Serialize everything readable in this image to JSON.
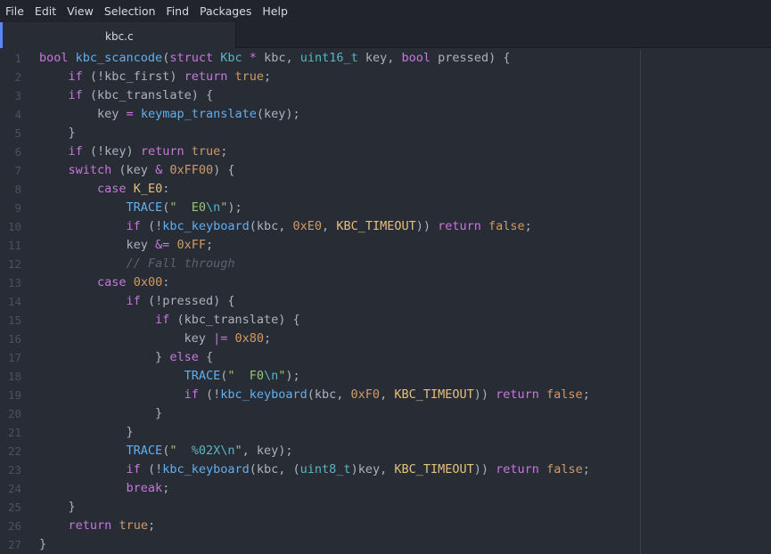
{
  "menubar": {
    "items": [
      "File",
      "Edit",
      "View",
      "Selection",
      "Find",
      "Packages",
      "Help"
    ]
  },
  "tabs": [
    {
      "title": "kbc.c",
      "active": true
    }
  ],
  "colors": {
    "background": "#282c34",
    "accent": "#568af2",
    "keyword": "#c678dd",
    "function": "#61afef",
    "type": "#56b6c2",
    "number": "#d19a66",
    "string": "#98c379",
    "comment": "#5c6370"
  },
  "editor": {
    "lines": [
      {
        "n": "1",
        "tokens": [
          [
            "kw",
            "bool"
          ],
          [
            "plain",
            " "
          ],
          [
            "fn",
            "kbc_scancode"
          ],
          [
            "plain",
            "("
          ],
          [
            "kw",
            "struct"
          ],
          [
            "plain",
            " "
          ],
          [
            "type",
            "Kbc"
          ],
          [
            "plain",
            " "
          ],
          [
            "op",
            "*"
          ],
          [
            "plain",
            " kbc, "
          ],
          [
            "type",
            "uint16_t"
          ],
          [
            "plain",
            " key, "
          ],
          [
            "kw",
            "bool"
          ],
          [
            "plain",
            " pressed) {"
          ]
        ]
      },
      {
        "n": "2",
        "tokens": [
          [
            "plain",
            "    "
          ],
          [
            "kw",
            "if"
          ],
          [
            "plain",
            " (!kbc_first) "
          ],
          [
            "kw",
            "return"
          ],
          [
            "plain",
            " "
          ],
          [
            "const",
            "true"
          ],
          [
            "plain",
            ";"
          ]
        ]
      },
      {
        "n": "3",
        "tokens": [
          [
            "plain",
            "    "
          ],
          [
            "kw",
            "if"
          ],
          [
            "plain",
            " (kbc_translate) {"
          ]
        ]
      },
      {
        "n": "4",
        "tokens": [
          [
            "plain",
            "        key "
          ],
          [
            "op",
            "="
          ],
          [
            "plain",
            " "
          ],
          [
            "fn",
            "keymap_translate"
          ],
          [
            "plain",
            "(key);"
          ]
        ]
      },
      {
        "n": "5",
        "tokens": [
          [
            "plain",
            "    }"
          ]
        ]
      },
      {
        "n": "6",
        "tokens": [
          [
            "plain",
            "    "
          ],
          [
            "kw",
            "if"
          ],
          [
            "plain",
            " (!key) "
          ],
          [
            "kw",
            "return"
          ],
          [
            "plain",
            " "
          ],
          [
            "const",
            "true"
          ],
          [
            "plain",
            ";"
          ]
        ]
      },
      {
        "n": "7",
        "tokens": [
          [
            "plain",
            "    "
          ],
          [
            "kw",
            "switch"
          ],
          [
            "plain",
            " (key "
          ],
          [
            "op",
            "&"
          ],
          [
            "plain",
            " "
          ],
          [
            "num",
            "0xFF00"
          ],
          [
            "plain",
            ") {"
          ]
        ]
      },
      {
        "n": "8",
        "tokens": [
          [
            "plain",
            "        "
          ],
          [
            "kw",
            "case"
          ],
          [
            "plain",
            " "
          ],
          [
            "ent",
            "K_E0"
          ],
          [
            "plain",
            ":"
          ]
        ]
      },
      {
        "n": "9",
        "tokens": [
          [
            "plain",
            "            "
          ],
          [
            "macro",
            "TRACE"
          ],
          [
            "plain",
            "("
          ],
          [
            "str",
            "\"  E0"
          ],
          [
            "esc",
            "\\n"
          ],
          [
            "str",
            "\""
          ],
          [
            "plain",
            ");"
          ]
        ]
      },
      {
        "n": "10",
        "tokens": [
          [
            "plain",
            "            "
          ],
          [
            "kw",
            "if"
          ],
          [
            "plain",
            " (!"
          ],
          [
            "fn",
            "kbc_keyboard"
          ],
          [
            "plain",
            "(kbc, "
          ],
          [
            "num",
            "0xE0"
          ],
          [
            "plain",
            ", "
          ],
          [
            "ent",
            "KBC_TIMEOUT"
          ],
          [
            "plain",
            ")) "
          ],
          [
            "kw",
            "return"
          ],
          [
            "plain",
            " "
          ],
          [
            "const",
            "false"
          ],
          [
            "plain",
            ";"
          ]
        ]
      },
      {
        "n": "11",
        "tokens": [
          [
            "plain",
            "            key "
          ],
          [
            "op",
            "&="
          ],
          [
            "plain",
            " "
          ],
          [
            "num",
            "0xFF"
          ],
          [
            "plain",
            ";"
          ]
        ]
      },
      {
        "n": "12",
        "tokens": [
          [
            "plain",
            "            "
          ],
          [
            "cmt",
            "// Fall through"
          ]
        ]
      },
      {
        "n": "13",
        "tokens": [
          [
            "plain",
            "        "
          ],
          [
            "kw",
            "case"
          ],
          [
            "plain",
            " "
          ],
          [
            "num",
            "0x00"
          ],
          [
            "plain",
            ":"
          ]
        ]
      },
      {
        "n": "14",
        "tokens": [
          [
            "plain",
            "            "
          ],
          [
            "kw",
            "if"
          ],
          [
            "plain",
            " (!pressed) {"
          ]
        ]
      },
      {
        "n": "15",
        "tokens": [
          [
            "plain",
            "                "
          ],
          [
            "kw",
            "if"
          ],
          [
            "plain",
            " (kbc_translate) {"
          ]
        ]
      },
      {
        "n": "16",
        "tokens": [
          [
            "plain",
            "                    key "
          ],
          [
            "op",
            "|="
          ],
          [
            "plain",
            " "
          ],
          [
            "num",
            "0x80"
          ],
          [
            "plain",
            ";"
          ]
        ]
      },
      {
        "n": "17",
        "tokens": [
          [
            "plain",
            "                } "
          ],
          [
            "kw",
            "else"
          ],
          [
            "plain",
            " {"
          ]
        ]
      },
      {
        "n": "18",
        "tokens": [
          [
            "plain",
            "                    "
          ],
          [
            "macro",
            "TRACE"
          ],
          [
            "plain",
            "("
          ],
          [
            "str",
            "\"  F0"
          ],
          [
            "esc",
            "\\n"
          ],
          [
            "str",
            "\""
          ],
          [
            "plain",
            ");"
          ]
        ]
      },
      {
        "n": "19",
        "tokens": [
          [
            "plain",
            "                    "
          ],
          [
            "kw",
            "if"
          ],
          [
            "plain",
            " (!"
          ],
          [
            "fn",
            "kbc_keyboard"
          ],
          [
            "plain",
            "(kbc, "
          ],
          [
            "num",
            "0xF0"
          ],
          [
            "plain",
            ", "
          ],
          [
            "ent",
            "KBC_TIMEOUT"
          ],
          [
            "plain",
            ")) "
          ],
          [
            "kw",
            "return"
          ],
          [
            "plain",
            " "
          ],
          [
            "const",
            "false"
          ],
          [
            "plain",
            ";"
          ]
        ]
      },
      {
        "n": "20",
        "tokens": [
          [
            "plain",
            "                }"
          ]
        ]
      },
      {
        "n": "21",
        "tokens": [
          [
            "plain",
            "            }"
          ]
        ]
      },
      {
        "n": "22",
        "tokens": [
          [
            "plain",
            "            "
          ],
          [
            "macro",
            "TRACE"
          ],
          [
            "plain",
            "("
          ],
          [
            "str",
            "\"  "
          ],
          [
            "esc",
            "%02X\\n"
          ],
          [
            "str",
            "\""
          ],
          [
            "plain",
            ", key);"
          ]
        ]
      },
      {
        "n": "23",
        "tokens": [
          [
            "plain",
            "            "
          ],
          [
            "kw",
            "if"
          ],
          [
            "plain",
            " (!"
          ],
          [
            "fn",
            "kbc_keyboard"
          ],
          [
            "plain",
            "(kbc, ("
          ],
          [
            "type",
            "uint8_t"
          ],
          [
            "plain",
            ")key, "
          ],
          [
            "ent",
            "KBC_TIMEOUT"
          ],
          [
            "plain",
            ")) "
          ],
          [
            "kw",
            "return"
          ],
          [
            "plain",
            " "
          ],
          [
            "const",
            "false"
          ],
          [
            "plain",
            ";"
          ]
        ]
      },
      {
        "n": "24",
        "tokens": [
          [
            "plain",
            "            "
          ],
          [
            "kw",
            "break"
          ],
          [
            "plain",
            ";"
          ]
        ]
      },
      {
        "n": "25",
        "tokens": [
          [
            "plain",
            "    }"
          ]
        ]
      },
      {
        "n": "26",
        "tokens": [
          [
            "plain",
            "    "
          ],
          [
            "kw",
            "return"
          ],
          [
            "plain",
            " "
          ],
          [
            "const",
            "true"
          ],
          [
            "plain",
            ";"
          ]
        ]
      },
      {
        "n": "27",
        "tokens": [
          [
            "plain",
            "}"
          ]
        ]
      }
    ]
  }
}
